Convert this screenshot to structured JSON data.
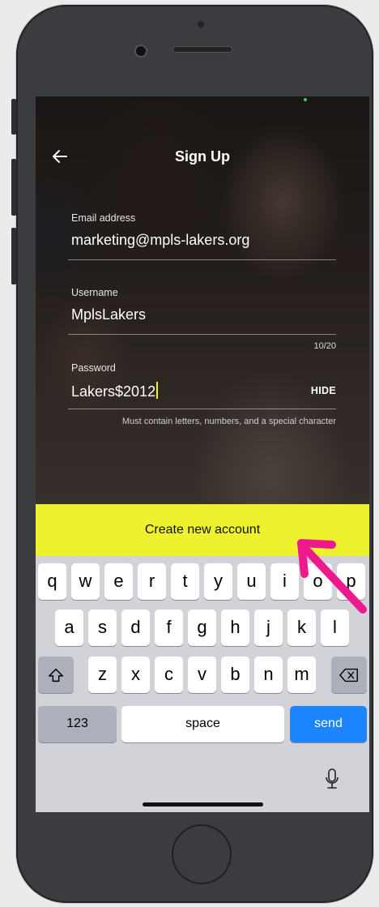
{
  "screen": {
    "title": "Sign Up",
    "back_icon": "arrow-left-icon"
  },
  "form": {
    "email": {
      "label": "Email address",
      "value": "marketing@mpls-lakers.org"
    },
    "username": {
      "label": "Username",
      "value": "MplsLakers",
      "counter": "10/20"
    },
    "password": {
      "label": "Password",
      "value": "Lakers$2012",
      "toggle_label": "HIDE",
      "helper": "Must contain letters, numbers, and a special character"
    }
  },
  "actions": {
    "create_account_label": "Create new account"
  },
  "keyboard": {
    "row1": [
      "q",
      "w",
      "e",
      "r",
      "t",
      "y",
      "u",
      "i",
      "o",
      "p"
    ],
    "row2": [
      "a",
      "s",
      "d",
      "f",
      "g",
      "h",
      "j",
      "k",
      "l"
    ],
    "row3": [
      "z",
      "x",
      "c",
      "v",
      "b",
      "n",
      "m"
    ],
    "numbers_label": "123",
    "space_label": "space",
    "send_label": "send"
  },
  "colors": {
    "accent_button": "#eef22e",
    "send_key": "#1d84ff",
    "annotation_arrow": "#ec1a8c"
  }
}
